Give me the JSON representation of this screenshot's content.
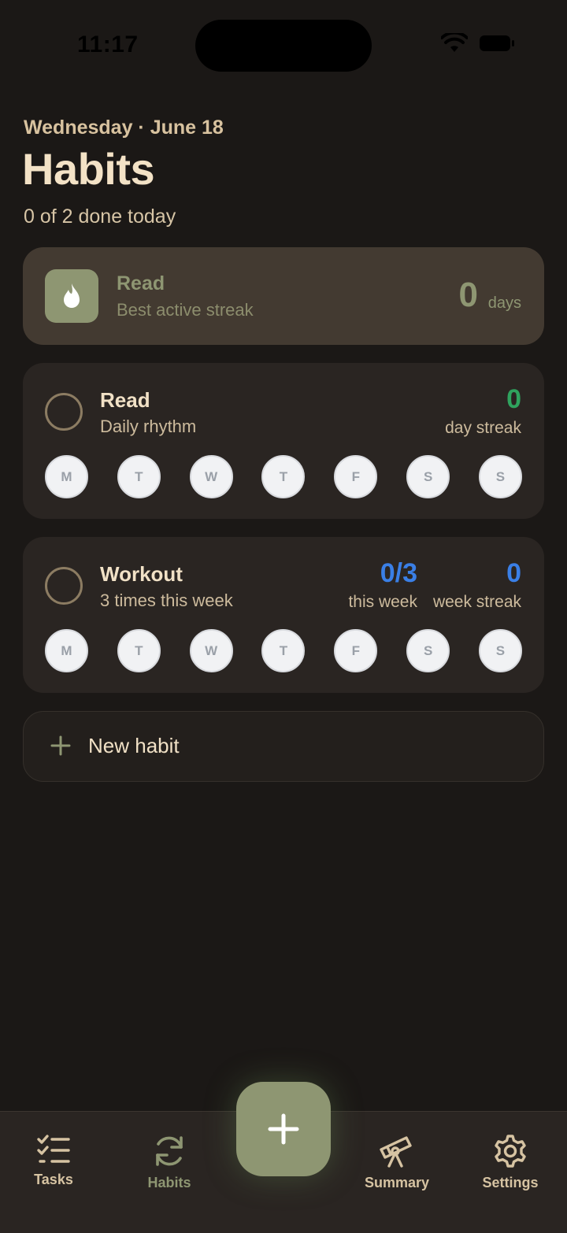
{
  "status_bar": {
    "time": "11:17"
  },
  "header": {
    "date": "Wednesday · June 18",
    "title": "Habits",
    "progress": "0 of 2 done today"
  },
  "best_streak": {
    "habit": "Read",
    "label": "Best active streak",
    "count": "0",
    "unit": "days"
  },
  "habits": [
    {
      "name": "Read",
      "description": "Daily rhythm",
      "stats": [
        {
          "value": "0",
          "label": "day streak",
          "color": "#2fa35e"
        }
      ],
      "days": [
        "M",
        "T",
        "W",
        "T",
        "F",
        "S",
        "S"
      ]
    },
    {
      "name": "Workout",
      "description": "3 times this week",
      "stats": [
        {
          "value": "0/3",
          "label": "this week",
          "color": "#3a7fe6"
        },
        {
          "value": "0",
          "label": "week streak",
          "color": "#3a7fe6"
        }
      ],
      "days": [
        "M",
        "T",
        "W",
        "T",
        "F",
        "S",
        "S"
      ]
    }
  ],
  "new_habit": {
    "label": "New habit"
  },
  "tabbar": {
    "tabs": [
      {
        "label": "Tasks",
        "icon": "checklist-icon"
      },
      {
        "label": "Habits",
        "icon": "refresh-icon",
        "active": true
      },
      {
        "label": "Summary",
        "icon": "telescope-icon"
      },
      {
        "label": "Settings",
        "icon": "gear-icon"
      }
    ],
    "fab_icon": "plus-icon"
  },
  "colors": {
    "background": "#1b1816",
    "accent": "#8e9672",
    "card": "#2a2522",
    "streak_card": "#433a31",
    "green": "#2fa35e",
    "blue": "#3a7fe6"
  }
}
